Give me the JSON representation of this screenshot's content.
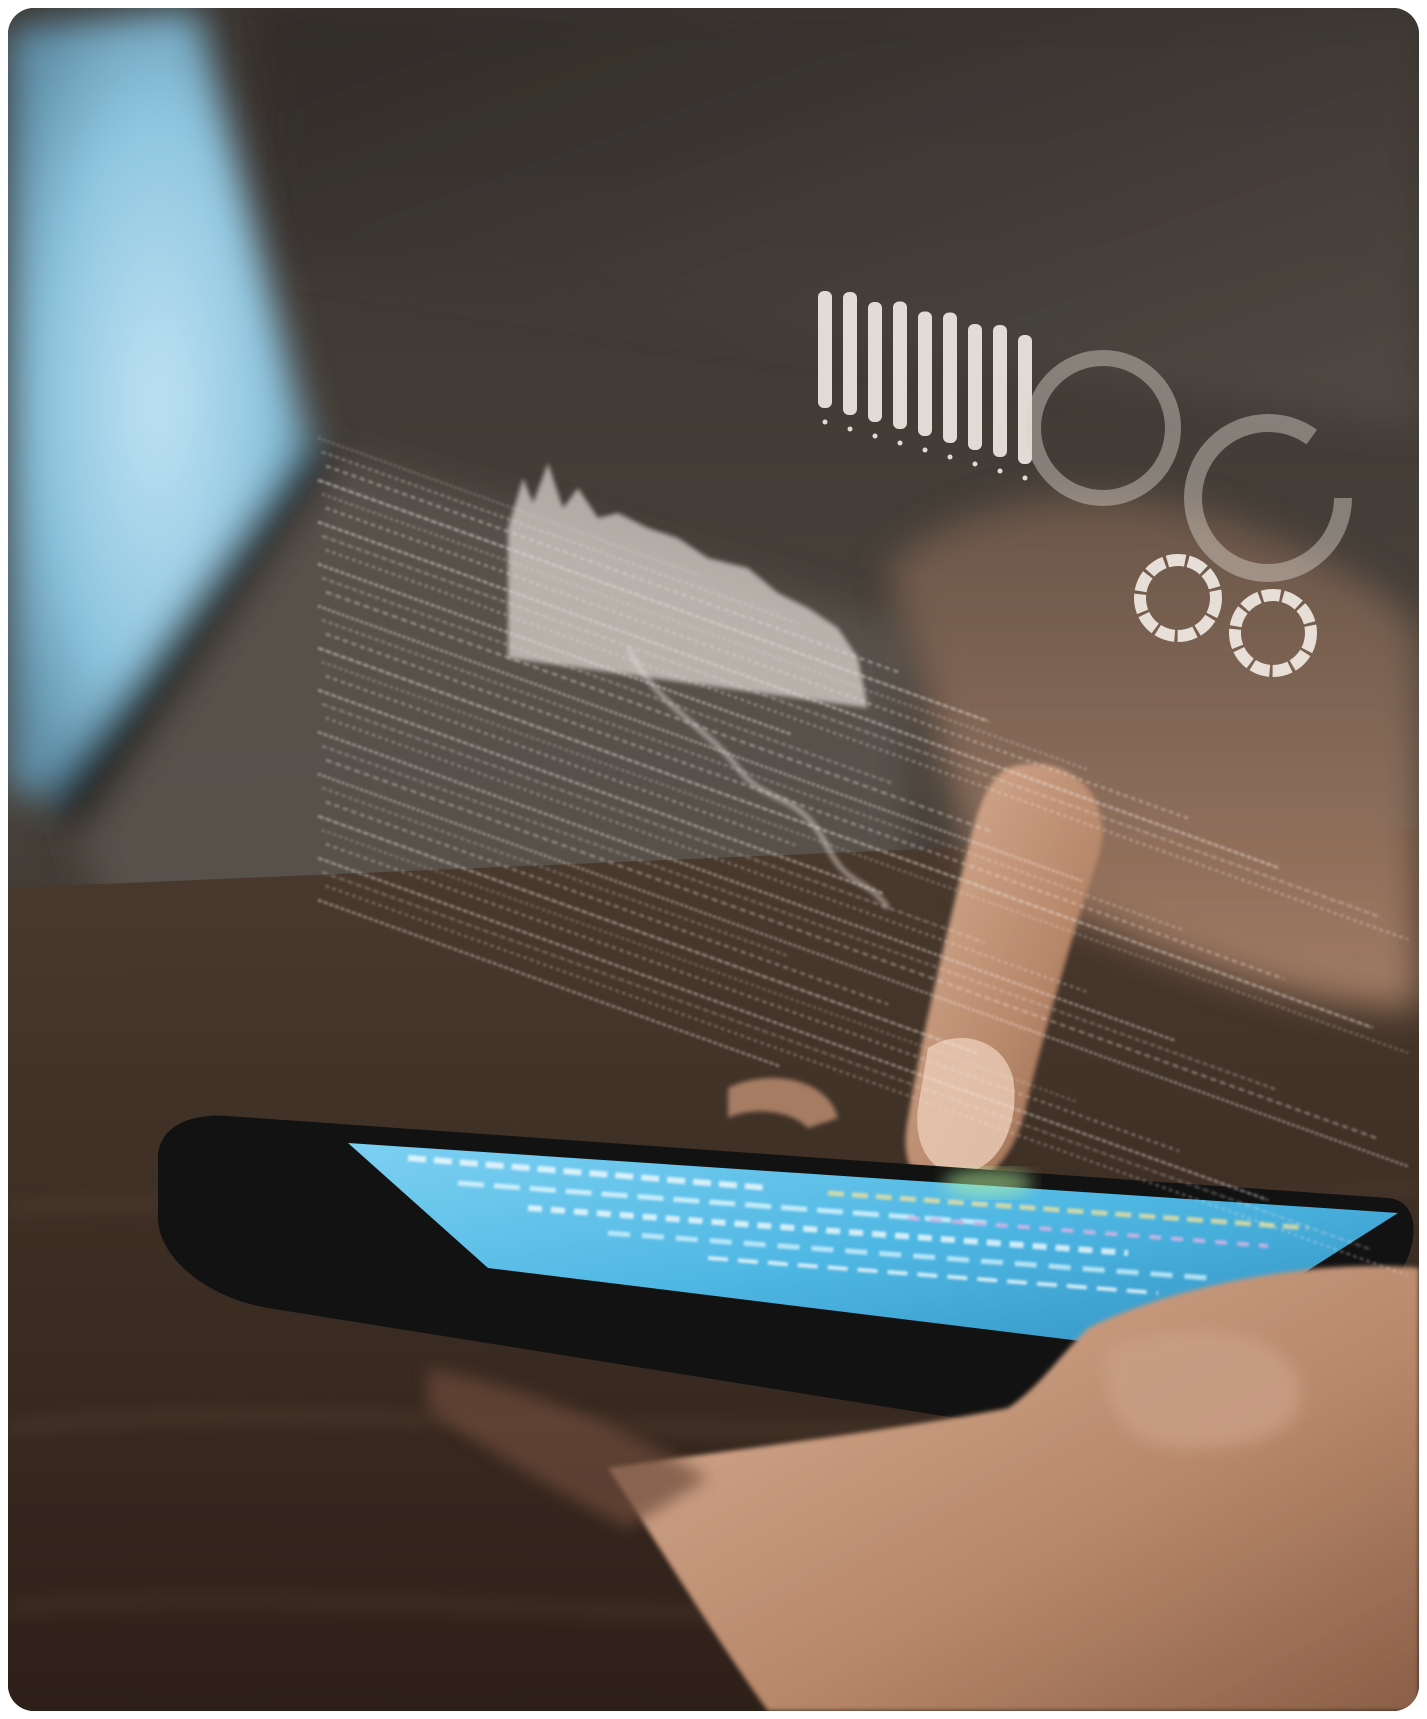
{
  "photo": {
    "subject": "stock-photo",
    "elements": [
      "laptop",
      "smartphone",
      "hand",
      "holographic-overlay"
    ],
    "colors": {
      "background_dark": "#2b2622",
      "laptop_screen": "#9ecfe6",
      "phone_screen": "#4fb7e3",
      "phone_body": "#121212",
      "skin": "#c99a78",
      "table_wood": "#3a2a20",
      "hologram": "#f2ece6"
    }
  },
  "hologram": {
    "bar_chart_levels": [
      0.78,
      0.82,
      0.8,
      0.85,
      0.83,
      0.87,
      0.84,
      0.88,
      0.86
    ],
    "rings": [
      {
        "name": "large-ring-1",
        "fill_fraction": 1.0
      },
      {
        "name": "large-ring-2",
        "fill_fraction": 0.85
      },
      {
        "name": "small-ring-1",
        "fill_fraction": 1.0
      },
      {
        "name": "small-ring-2",
        "fill_fraction": 1.0
      }
    ]
  }
}
